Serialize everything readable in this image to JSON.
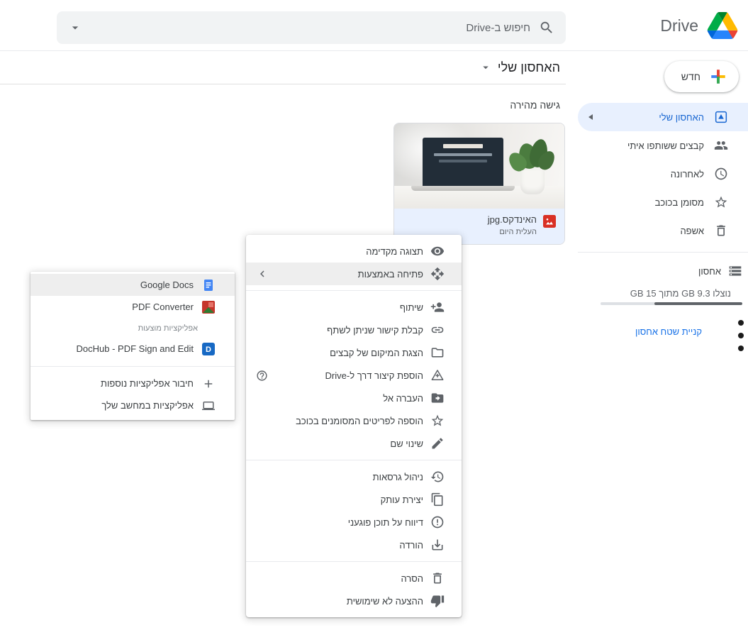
{
  "topbar": {
    "logo_text": "Drive",
    "search_placeholder": "חיפוש ב-Drive"
  },
  "sidebar": {
    "new_button_label": "חדש",
    "items": [
      {
        "label": "האחסון שלי"
      },
      {
        "label": "קבצים ששותפו איתי"
      },
      {
        "label": "לאחרונה"
      },
      {
        "label": "מסומן בכוכב"
      },
      {
        "label": "אשפה"
      }
    ],
    "storage": {
      "label": "אחסון",
      "usage_text": "נוצלו 9.3 GB מתוך 15 GB",
      "used_percent": 62,
      "buy_link_label": "קניית שטח אחסון"
    }
  },
  "content": {
    "page_title": "האחסון שלי",
    "section_label": "גישה מהירה",
    "file_card": {
      "file_name": "האינדקס.jpg",
      "uploaded_text": "העלית היום"
    }
  },
  "context_menu": {
    "sections": [
      {
        "items": [
          {
            "label": "תצוגה מקדימה"
          },
          {
            "label": "פתיחה באמצעות"
          }
        ]
      },
      {
        "items": [
          {
            "label": "שיתוף"
          },
          {
            "label": "קבלת קישור שניתן לשתף"
          },
          {
            "label": "הצגת המיקום של קבצים"
          },
          {
            "label": "הוספת קיצור דרך ל-Drive"
          },
          {
            "label": "העברה אל"
          },
          {
            "label": "הוספה לפריטים המסומנים בכוכב"
          },
          {
            "label": "שינוי שם"
          }
        ]
      },
      {
        "items": [
          {
            "label": "ניהול גרסאות"
          },
          {
            "label": "יצירת עותק"
          },
          {
            "label": "דיווח על תוכן פוגעני"
          },
          {
            "label": "הורדה"
          }
        ]
      },
      {
        "items": [
          {
            "label": "הסרה"
          },
          {
            "label": "ההצעה לא שימושית"
          }
        ]
      }
    ]
  },
  "submenu": {
    "apps": [
      {
        "label": "Google Docs"
      },
      {
        "label": "PDF Converter"
      }
    ],
    "section_label": "אפליקציות מוצעות",
    "suggested_apps": [
      {
        "label": "DocHub - PDF Sign and Edit"
      }
    ],
    "footer_actions": [
      {
        "label": "חיבור אפליקציות נוספות"
      },
      {
        "label": "אפליקציות במחשב שלך"
      }
    ]
  },
  "colors": {
    "accent_blue": "#1a73e8",
    "active_item_bg": "#e8f0fe",
    "active_item_text": "#1967d2",
    "selected_file_bg": "#e8f0fe",
    "file_icon_red": "#d93025"
  }
}
